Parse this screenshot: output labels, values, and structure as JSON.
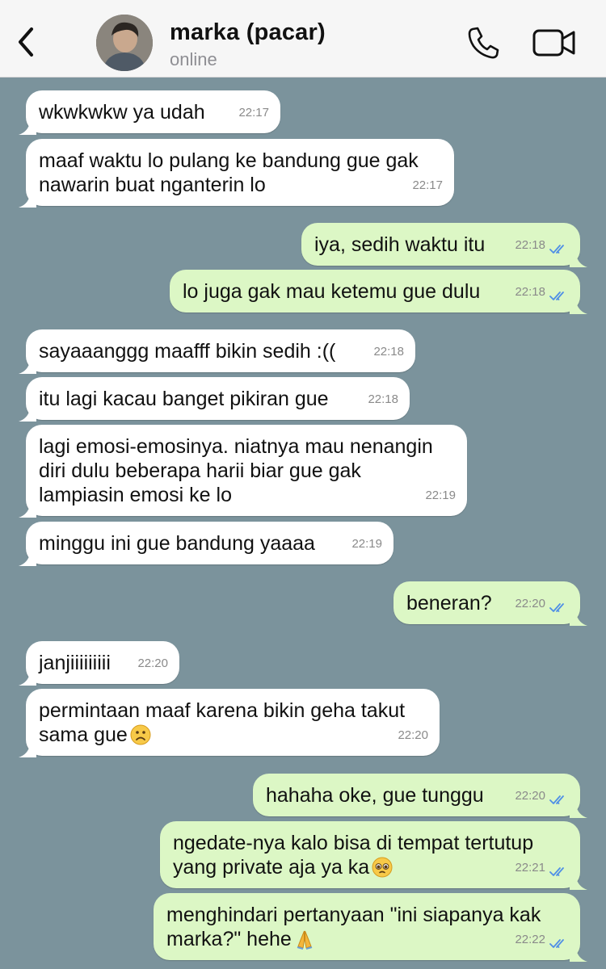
{
  "header": {
    "contact_name": "marka (pacar)",
    "status": "online"
  },
  "colors": {
    "chat_background": "#7b939c",
    "incoming_bubble": "#ffffff",
    "outgoing_bubble": "#dcf7c5",
    "read_ticks": "#4f8fe6"
  },
  "icons": {
    "back": "chevron-left-icon",
    "call": "phone-icon",
    "video": "video-camera-icon",
    "read": "double-check-icon",
    "emoji_sad": "slightly-frowning-face-emoji",
    "emoji_pleading": "pleading-face-emoji",
    "emoji_pray": "folded-hands-emoji"
  },
  "messages": [
    {
      "dir": "in",
      "text": "wkwkwkw ya udah",
      "time": "22:17"
    },
    {
      "dir": "in",
      "text": "maaf waktu lo pulang ke bandung gue gak\nnawarin buat nganterin lo",
      "time": "22:17"
    },
    {
      "dir": "out",
      "text": "iya, sedih waktu itu",
      "time": "22:18",
      "read": true
    },
    {
      "dir": "out",
      "text": "lo juga gak mau ketemu gue dulu",
      "time": "22:18",
      "read": true
    },
    {
      "dir": "in",
      "text": "sayaaanggg maafff bikin sedih :((",
      "time": "22:18"
    },
    {
      "dir": "in",
      "text": "itu lagi kacau banget pikiran gue",
      "time": "22:18"
    },
    {
      "dir": "in",
      "text": "lagi emosi-emosinya. niatnya mau nenangin\ndiri dulu beberapa harii biar gue gak\nlampiasin emosi ke lo",
      "time": "22:19"
    },
    {
      "dir": "in",
      "text": "minggu ini gue bandung yaaaa",
      "time": "22:19"
    },
    {
      "dir": "out",
      "text": "beneran?",
      "time": "22:20",
      "read": true
    },
    {
      "dir": "in",
      "text": "janjiiiiiiiii",
      "time": "22:20"
    },
    {
      "dir": "in",
      "text": "permintaan maaf karena bikin geha takut\nsama gue",
      "time": "22:20",
      "emoji": "emoji_sad"
    },
    {
      "dir": "out",
      "text": "hahaha oke, gue tunggu",
      "time": "22:20",
      "read": true
    },
    {
      "dir": "out",
      "text": "ngedate-nya kalo bisa di tempat tertutup\nyang private aja ya ka",
      "time": "22:21",
      "read": true,
      "emoji": "emoji_pleading"
    },
    {
      "dir": "out",
      "text": "menghindari pertanyaan \"ini siapanya kak\nmarka?\" hehe",
      "time": "22:22",
      "read": true,
      "emoji": "emoji_pray"
    }
  ]
}
